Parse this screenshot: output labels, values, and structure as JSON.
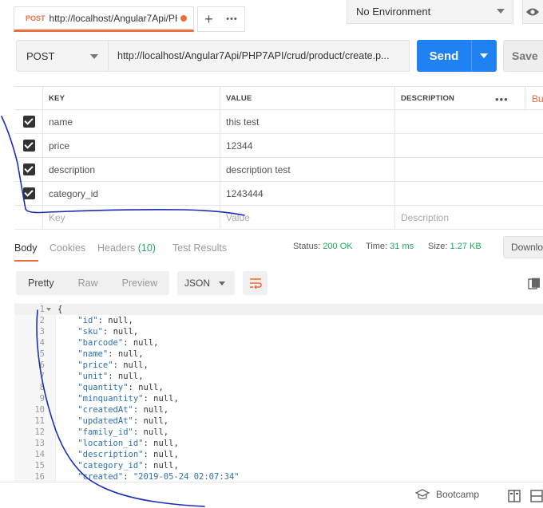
{
  "tabbar": {
    "tab_method": "POST",
    "tab_url": "http://localhost/Angular7Api/PH",
    "add_label": "+",
    "more_label": "•••",
    "environment": "No Environment"
  },
  "request": {
    "method": "POST",
    "url": "http://localhost/Angular7Api/PHP7API/crud/product/create.p...",
    "send_label": "Send",
    "save_label": "Save"
  },
  "params": {
    "headers": {
      "key": "KEY",
      "value": "VALUE",
      "description": "DESCRIPTION",
      "more": "•••",
      "bulk": "Bulk"
    },
    "rows": [
      {
        "key": "name",
        "value": "this test",
        "description": ""
      },
      {
        "key": "price",
        "value": "12344",
        "description": ""
      },
      {
        "key": "description",
        "value": "description test",
        "description": ""
      },
      {
        "key": "category_id",
        "value": "1243444",
        "description": ""
      }
    ],
    "placeholder": {
      "key": "Key",
      "value": "Value",
      "description": "Description"
    }
  },
  "response": {
    "tabs": {
      "body": "Body",
      "cookies": "Cookies",
      "headers": "Headers",
      "headers_count": "(10)",
      "tests": "Test Results"
    },
    "status_label": "Status:",
    "status_value": "200 OK",
    "time_label": "Time:",
    "time_value": "31 ms",
    "size_label": "Size:",
    "size_value": "1.27 KB",
    "download_label": "Downlo",
    "formats": {
      "pretty": "Pretty",
      "raw": "Raw",
      "preview": "Preview"
    },
    "language": "JSON"
  },
  "code_lines": [
    {
      "n": "1",
      "text": "{"
    },
    {
      "n": "2",
      "key": "\"id\"",
      "val": "null"
    },
    {
      "n": "3",
      "key": "\"sku\"",
      "val": "null"
    },
    {
      "n": "4",
      "key": "\"barcode\"",
      "val": "null"
    },
    {
      "n": "5",
      "key": "\"name\"",
      "val": "null"
    },
    {
      "n": "6",
      "key": "\"price\"",
      "val": "null"
    },
    {
      "n": "7",
      "key": "\"unit\"",
      "val": "null"
    },
    {
      "n": "8",
      "key": "\"quantity\"",
      "val": "null"
    },
    {
      "n": "9",
      "key": "\"minquantity\"",
      "val": "null"
    },
    {
      "n": "10",
      "key": "\"createdAt\"",
      "val": "null"
    },
    {
      "n": "11",
      "key": "\"updatedAt\"",
      "val": "null"
    },
    {
      "n": "12",
      "key": "\"family_id\"",
      "val": "null"
    },
    {
      "n": "13",
      "key": "\"location_id\"",
      "val": "null"
    },
    {
      "n": "14",
      "key": "\"description\"",
      "val": "null"
    },
    {
      "n": "15",
      "key": "\"category_id\"",
      "val": "null"
    },
    {
      "n": "16",
      "key": "\"created\"",
      "val": "\"2019-05-24 02:07:34\""
    }
  ],
  "bottom": {
    "bootcamp": "Bootcamp"
  },
  "colors": {
    "accent": "#f26b3a",
    "send": "#1f81f2",
    "success": "#1fa95c",
    "annotation": "#1a2fb8"
  }
}
